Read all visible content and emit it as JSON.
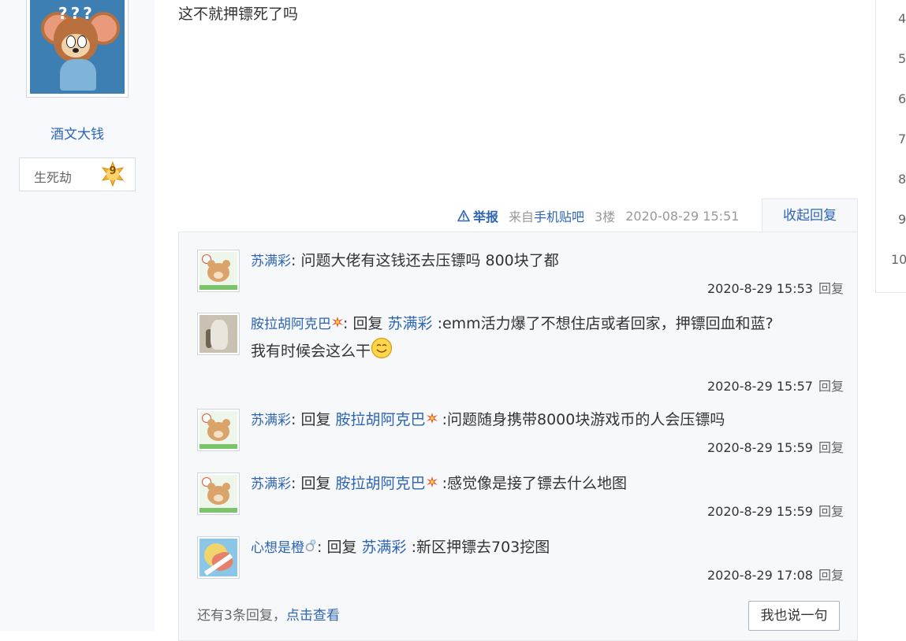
{
  "author": {
    "name": "酒文大钱",
    "level_title": "生死劫",
    "level": "9",
    "avatar_text": "???"
  },
  "post": {
    "content": "这不就押镖死了吗",
    "report_label": "举报",
    "client_prefix": "来自",
    "client_link": "手机贴吧",
    "floor": "3楼",
    "time": "2020-08-29 15:51",
    "collapse_label": "收起回复"
  },
  "replies": [
    {
      "user": "苏满彩",
      "avatar": "bear-avatar",
      "reply_to": "",
      "text": "问题大佬有这钱还去压镖吗 800块了都",
      "time": "2020-8-29 15:53",
      "reply_label": "回复"
    },
    {
      "user": "胺拉胡阿克巴",
      "avatar": "cat-avatar",
      "reply_to": "苏满彩",
      "text": ":emm活力爆了不想住店或者回家，押镖回血和蓝?",
      "text2": "我有时候会这么干",
      "time": "2020-8-29 15:57",
      "reply_label": "回复"
    },
    {
      "user": "苏满彩",
      "avatar": "bear-avatar",
      "reply_to": "胺拉胡阿克巴",
      "text": ":问题随身携带8000块游戏币的人会压镖吗",
      "time": "2020-8-29 15:59",
      "reply_label": "回复"
    },
    {
      "user": "苏满彩",
      "avatar": "bear-avatar",
      "reply_to": "胺拉胡阿克巴",
      "text": ":感觉像是接了镖去什么地图",
      "time": "2020-8-29 15:59",
      "reply_label": "回复"
    },
    {
      "user": "心想是橙",
      "avatar": "flower-avatar",
      "reply_to": "苏满彩",
      "text": ":新区押镖去703挖图",
      "time": "2020-8-29 17:08",
      "reply_label": "回复"
    }
  ],
  "reply_word": "回复",
  "colon": ":",
  "more": {
    "prefix": "还有3条回复，",
    "link": "点击查看"
  },
  "say_button": "我也说一句",
  "pagination": [
    "4",
    "5",
    "6",
    "7",
    "8",
    "9",
    "10"
  ],
  "colors": {
    "link": "#2d64b3",
    "panel_bg": "#f7f8fa",
    "badge": "#f2b233"
  }
}
